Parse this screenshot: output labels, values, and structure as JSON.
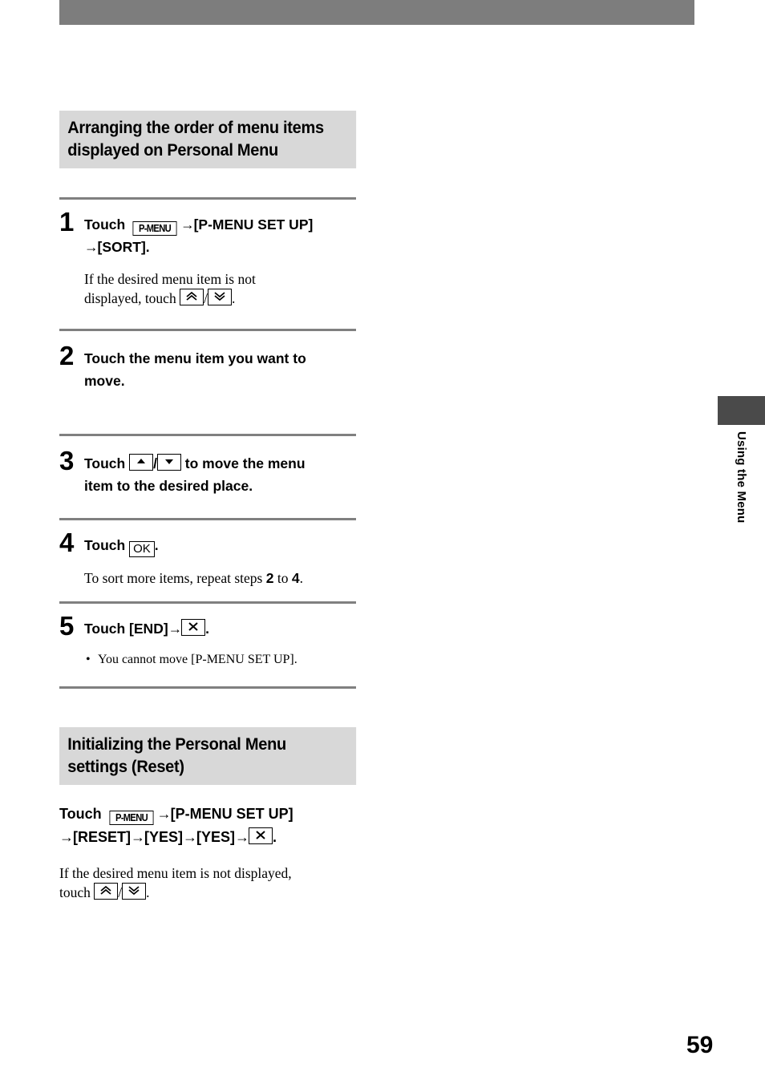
{
  "page": {
    "number": "59",
    "side_tab_label": "Using the Menu"
  },
  "section1": {
    "heading_line1": "Arranging the order of menu items",
    "heading_line2": "displayed on Personal Menu",
    "steps": [
      {
        "number": "1",
        "title_pre": "Touch ",
        "icon": "p-menu-icon",
        "icon_label": "P-MENU",
        "arrow": "→",
        "title_mid": "[P-MENU SET UP]",
        "title_line2_arrow": "→",
        "title_line2": "[SORT].",
        "body_pre": "If the desired menu item is not",
        "body_line2_pre": "displayed, touch ",
        "body_icon_up": "page-up-icon",
        "body_sep": "/",
        "body_icon_down": "page-down-icon",
        "body_post": "."
      },
      {
        "number": "2",
        "title_line1": "Touch the menu item you want to",
        "title_line2": "move."
      },
      {
        "number": "3",
        "title_pre": "Touch ",
        "icon_up": "move-up-icon",
        "sep": "/",
        "icon_down": "move-down-icon",
        "title_post": " to move the menu",
        "title_line2": "item to the desired place."
      },
      {
        "number": "4",
        "title_pre": "Touch ",
        "icon_label": "OK",
        "title_post": ".",
        "body_pre": "To sort more items, repeat steps ",
        "body_num1": "2",
        "body_mid": " to ",
        "body_num2": "4",
        "body_post": "."
      },
      {
        "number": "5",
        "title_pre": "Touch [END]",
        "arrow": "→",
        "icon": "close-icon",
        "title_post": ".",
        "bullet_dot": "•",
        "bullet_text": "You cannot move [P-MENU SET UP]."
      }
    ]
  },
  "section2": {
    "heading_line1": "Initializing the Personal Menu",
    "heading_line2": "settings (Reset)",
    "command_pre": "Touch ",
    "command_icon_label": "P-MENU",
    "command_arrow1": "→",
    "command_part1": "[P-MENU SET UP]",
    "command_arrow2": "→",
    "command_part2": "[RESET]",
    "command_arrow3": "→",
    "command_part3": "[YES]",
    "command_arrow4": "→",
    "command_part4": "[YES]",
    "command_arrow5": "→",
    "command_close_icon": "close-icon",
    "command_post": ".",
    "note_line1": "If the desired menu item is not displayed,",
    "note_line2_pre": "touch ",
    "note_icon_up": "page-up-icon",
    "note_sep": "/",
    "note_icon_down": "page-down-icon",
    "note_post": "."
  },
  "colors": {
    "header_band": "#7d7d7d",
    "heading_block": "#d8d8d8",
    "rule": "#808080",
    "tab_block": "#4a4a4a"
  }
}
